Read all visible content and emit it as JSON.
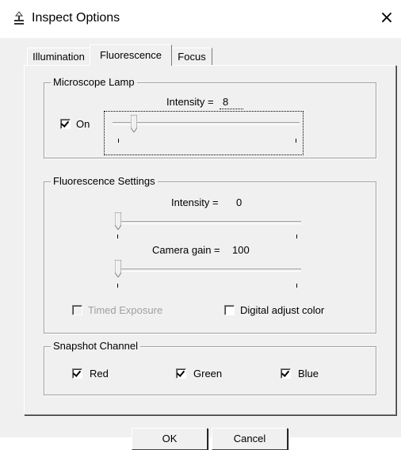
{
  "window": {
    "title": "Inspect Options",
    "close_glyph": "×",
    "icon": "stage-icon"
  },
  "tabs": [
    {
      "label": "Illumination",
      "active": false
    },
    {
      "label": "Fluorescence",
      "active": true
    },
    {
      "label": "Focus",
      "active": false
    }
  ],
  "lamp": {
    "group_title": "Microscope Lamp",
    "intensity_label": "Intensity = ",
    "intensity_value": "8",
    "on_label": "On",
    "on_checked": true
  },
  "fluor": {
    "group_title": "Fluorescence Settings",
    "intensity_label": "Intensity = ",
    "intensity_value": "0",
    "gain_label": "Camera gain = ",
    "gain_value": "100",
    "timed_exposure_label": "Timed Exposure",
    "timed_exposure_checked": false,
    "timed_exposure_enabled": false,
    "digital_adjust_label": "Digital adjust color",
    "digital_adjust_checked": false
  },
  "snapshot": {
    "group_title": "Snapshot Channel",
    "channels": [
      {
        "label": "Red",
        "checked": true
      },
      {
        "label": "Green",
        "checked": true
      },
      {
        "label": "Blue",
        "checked": true
      }
    ]
  },
  "buttons": {
    "ok": "OK",
    "cancel": "Cancel"
  }
}
